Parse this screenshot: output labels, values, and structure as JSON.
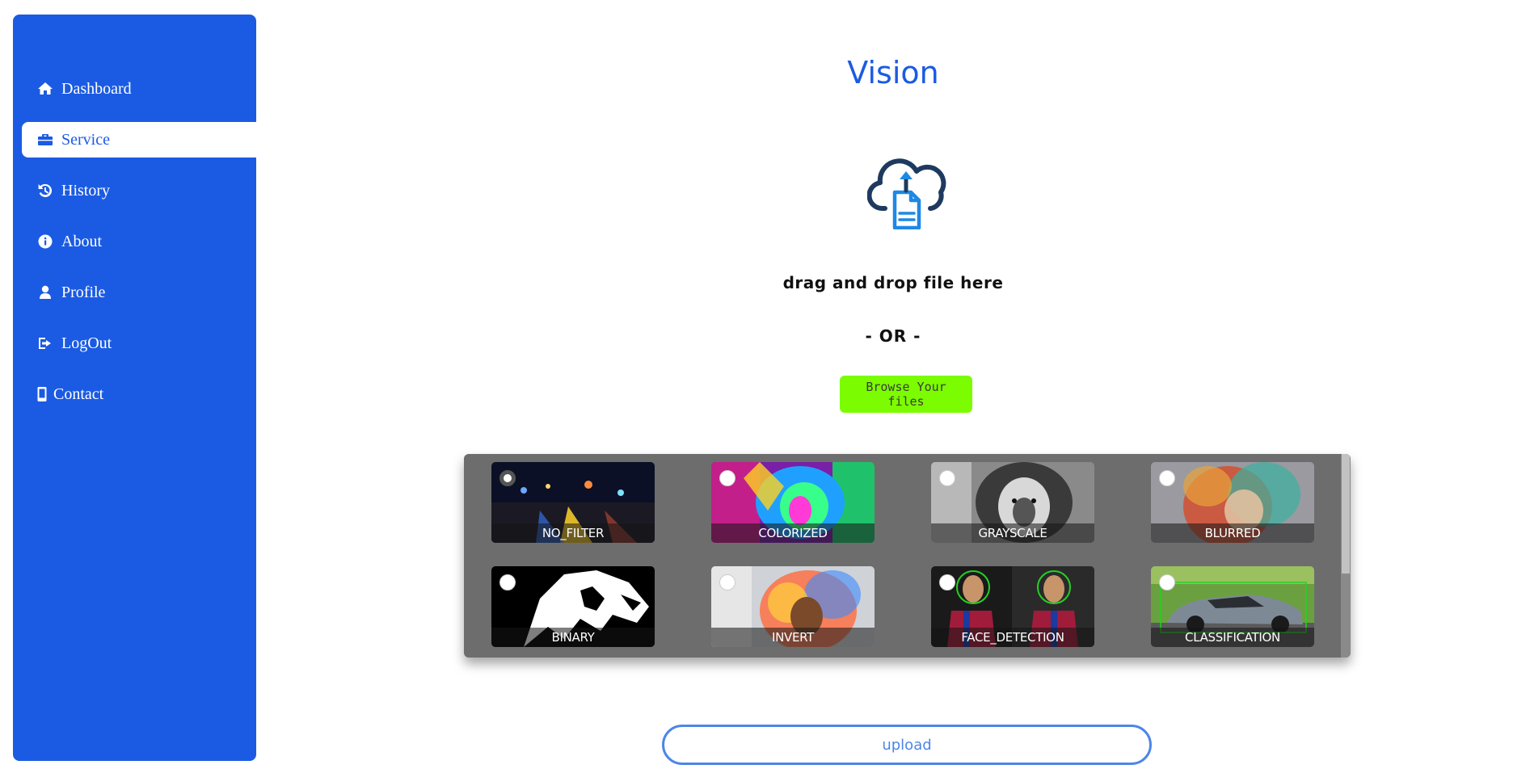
{
  "sidebar": {
    "items": [
      {
        "label": "Dashboard",
        "icon": "home-icon",
        "active": false
      },
      {
        "label": "Service",
        "icon": "briefcase-icon",
        "active": true
      },
      {
        "label": "History",
        "icon": "history-icon",
        "active": false
      },
      {
        "label": "About",
        "icon": "info-icon",
        "active": false
      },
      {
        "label": "Profile",
        "icon": "user-icon",
        "active": false
      },
      {
        "label": "LogOut",
        "icon": "logout-icon",
        "active": false
      },
      {
        "label": "Contact",
        "icon": "mobile-icon",
        "active": false
      }
    ]
  },
  "main": {
    "title": "Vision",
    "upload_icon": "cloud-upload-document-icon",
    "drag_text": "drag and drop file here",
    "or_text": "- OR -",
    "browse_label": "Browse Your files",
    "upload_label": "upload"
  },
  "filters": [
    {
      "label": "NO_FILTER",
      "selected": true
    },
    {
      "label": "COLORIZED",
      "selected": false
    },
    {
      "label": "GRAYSCALE",
      "selected": false
    },
    {
      "label": "BLURRED",
      "selected": false
    },
    {
      "label": "BINARY",
      "selected": false
    },
    {
      "label": "INVERT",
      "selected": false
    },
    {
      "label": "FACE_DETECTION",
      "selected": false
    },
    {
      "label": "CLASSIFICATION",
      "selected": false
    }
  ],
  "colors": {
    "primary": "#1b5be3",
    "browse_button": "#7cfc00",
    "panel": "#6d6d6d",
    "upload_border": "#4d86e6"
  }
}
